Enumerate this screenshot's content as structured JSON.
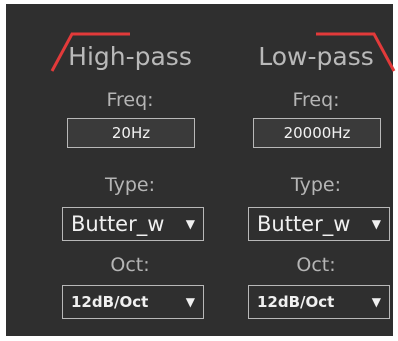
{
  "filters": {
    "high_pass": {
      "title": "High-pass",
      "freq_label": "Freq:",
      "freq_value": "20Hz",
      "type_label": "Type:",
      "type_value": "Butter_w",
      "oct_label": "Oct:",
      "oct_value": "12dB/Oct"
    },
    "low_pass": {
      "title": "Low-pass",
      "freq_label": "Freq:",
      "freq_value": "20000Hz",
      "type_label": "Type:",
      "type_value": "Butter_w",
      "oct_label": "Oct:",
      "oct_value": "12dB/Oct"
    }
  },
  "icons": {
    "dropdown_arrow": "chevron-down-icon",
    "high_pass_curve": "high-pass-curve-icon",
    "low_pass_curve": "low-pass-curve-icon"
  },
  "colors": {
    "panel_bg": "#2f2f2f",
    "curve": "#e23a3a",
    "text": "#b8b8b8"
  }
}
